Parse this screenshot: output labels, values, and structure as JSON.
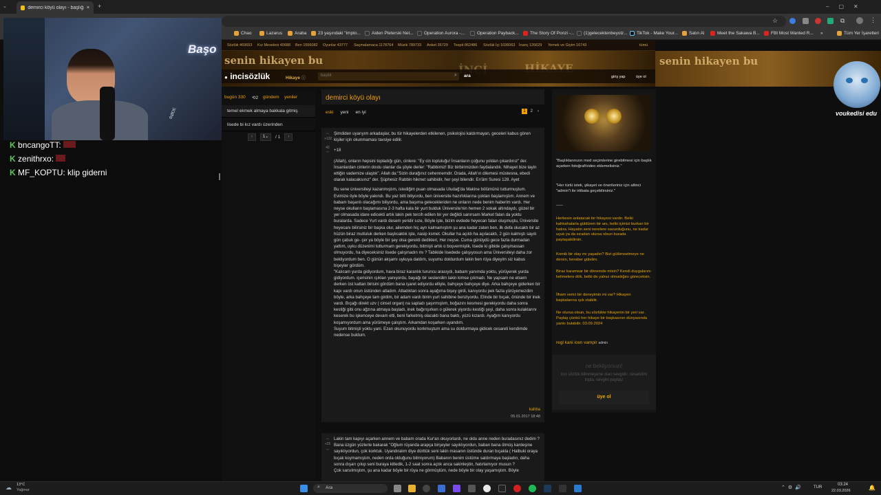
{
  "browser": {
    "tab_title": "demirci köyü olayı - başlığı açan",
    "tab_close": "×",
    "new_tab": "+",
    "bookmarks": [
      {
        "label": "Chao",
        "color": "#e5a23a"
      },
      {
        "label": "Lazarus",
        "color": "#e5a23a"
      },
      {
        "label": "Araba",
        "color": "#e5a23a"
      },
      {
        "label": "23 yaşındaki \"impto...",
        "color": "#e5a23a"
      },
      {
        "label": "Aiden Pleterski Net...",
        "color": "#333"
      },
      {
        "label": "Operation Aurora -...",
        "color": "#333"
      },
      {
        "label": "Operation Payback...",
        "color": "#333"
      },
      {
        "label": "The Story Of Ponzi -...",
        "color": "#d22"
      },
      {
        "label": "(1)gelecektenbeyolz...",
        "color": "#333"
      },
      {
        "label": "TikTok - Make Your...",
        "color": "#111"
      },
      {
        "label": "Satın Al",
        "color": "#e5a23a"
      },
      {
        "label": "Meet the Sakawa B...",
        "color": "#d22"
      },
      {
        "label": "FBI Most Wanted R...",
        "color": "#d22"
      },
      {
        "label": "»",
        "color": ""
      },
      {
        "label": "Tüm Yer İşaretleri",
        "color": "#e5a23a"
      }
    ]
  },
  "site": {
    "top_links": [
      "Sözlük 469693",
      "Kız Meselesi 40688",
      "Ben 1556082",
      "Oyunlar 43777",
      "Saçmalamaca 1178764",
      "Müzik 789733",
      "Anket 35729",
      "Tespit 862486",
      "Sözlük İçi 1036063",
      "İnanç 126629",
      "Yemek ve Giyim 16743",
      "tümü"
    ],
    "logo": "incisözlük",
    "section": "Hikaye",
    "search_placeholder": "başlık",
    "search_button": "ara",
    "login": "giriş yap",
    "signup": "üye ol",
    "banner_left": "senin hikayen bu",
    "banner_mid1": "İNCİ",
    "banner_mid2": "HİKAYE",
    "banner_right": "senin hikayen bu"
  },
  "left": {
    "today": "bugün 330",
    "refresh_count": "2",
    "gundem": "gündem",
    "yeniler": "yeniler",
    "topics": [
      "temel ekmek almaya bakkala gitmiş",
      "lisede bi kız vardı üzerinden"
    ],
    "page_current": "1",
    "page_total": "/ 1",
    "prev": "‹",
    "next": "›"
  },
  "topic": {
    "title": "demirci köyü olayı",
    "tabs": [
      "eski",
      "yeni",
      "en iyi"
    ],
    "pages": [
      "1",
      "2",
      "›"
    ]
  },
  "entries": [
    {
      "votes_up": "+132",
      "votes_down": "42",
      "author": "kahba",
      "date": "05.01.2017 18:48",
      "paragraphs": [
        "Şimdiden uyarıyım arkadaşlar, bu tür hikayelerden etkilenen, psikolojisi kaldırmayan, geceleri kabus gören kişiler için okunmaması tavsiye edilir.",
        "+18",
        "(Allah), onların hepsini topladığı gün, cinlere: \"Ey cin topluluğu! İnsanların çoğunu yoldan çıkardınız\" der. İnsanlardan cinlerin dostu olanlar da şöyle derler: \"Rabbimiz! Biz birbirimizden faydalandık. Nihayet bize tayin ettiğin vademize ulaştık\". Allah da:\"Sizin durağınız cehennemdir. Orada, Allah'ın dilemesi müstesna, ebedi olarak kalacaksınız\" der. Şüphesiz Rabbin hikmet sahibidir, her şeyi bilendir. En'âm Suresi 128. Ayet",
        "Bu sene üniversiteyi kazanmıştım, istediğim puan olmasada Uludağ'da Makine bölümünü tutturmuştum. Evimize öyle böyle yakındı. Bu yaz bitti biliyordu, ben üniversite hazırlıklarına çoktan başlamıştım. Annem ve babam başarılı olacağımı biliyordu, ama başıma gelecekleriden ne onların nede benim haberim vardı. Her neyse okulların başlamasına 2-3 hafta kala bir yurt bulduk Üniversite'nin hemen 2 sokak altındaydı, güzel bir yer olmasada idare edicekti artık lakin pek tercih edilen bir yer değildi sanırsam Market falan da yoktu buralarda. Sadece Yurt vardı desem yeridir sıze, Böyle işte, bizim evdede heyecan falan oluşmuştu, Üniversite heyecanı bilirsiniz bir başka olur, ailemden hiç ayrı kalmamıştım şu ana kadar zaten ben, ilk defa olucaktı bir az hüzün biraz mutluluk derken başlıcaktık işte, nasip ksmet. Okullar ha açıldı ha açılacaktı, 2 gün kalmıştı sayılı gün çabuk ge- çer ya böyle bir şey olsa gerekti dedikleri, Her neyse. Cuma günüydü gece fazla durmadan yattım, uyku düzenimi tutturmam gerekiyordu, bitmişti artık o boşvermişlik, lisede ki gibide çalışmassan olmuyordu, ha diyeceksiniz lisede çalışmadın mı ? Tabikide lisedede çalışıyosun ama Üniversiteyi daha zor bekliyordum ben. O günün akşamı uykuya daldım, suyumu doldurdum lakin ben rüya diyeyim siz kabus bişeyler gördüm.",
        "\"Kalıcam yurda gidiyordum, hava biraz karanlık turuncu arasıydı, babam yanımda yoktu, yürüyerek yurda gidiyordum. içerisinin ışıkları yanıyordu, bayağı bir seslendim lakin kimse çıkmadı. Ne yapsam ne etsem derken üst kattan birisini gördüm bana işaret ediyordu elliyle, bahçeye bahçeye diye. Arka bahçeye giderken bir kapı vardı onun üstünden atladım. Atladıktan sonra ayağıma bişey girdi, kanıyordu pek fazla yürüyemezdim böyle, arka bahçeye tam girdim, bir adam vardı birim yurt sahibine benziyordu. Elinde bir bıçak, önünde bir inek vardı. Bıçağı direkt uzv ( cinsel organ) na sapladı şaşırmıştım, boğazını kesmesi gerekiyordu daha sonra kestiği gibi onu ağzına atmaya başladı, inek bağırışırken o gülerek yiyordu kestiği şeyi, daha sonra kulaklarını keserek bu işkenceye devam etti, beni farketmiş olacaktı bana baktı, yüzü kızardı. Ayağım kanıyordu koşamıyordum ama yürümeye çalıştım. Arkamdan koşarken uyandım.",
        "Suyum bitmişti yoktu yani. Ezan okunuyordu korkmuştum ama su doldurmaya gidicek cesareti kendimde nedense buldum."
      ]
    },
    {
      "votes_up": "+25",
      "votes_down": "",
      "paragraphs": [
        "Lakin tam kapıyı açarken annem ve babam orada Kur'an okuyorlardı, ne oldu anne neden buradasınız dedim ? Bana üzgün yüzlerle bakarak \"Oğlum rüyanda arapça birşeyler sayıklıyordun, baban bana ölmüş kardeşine sayıklıyordun, çok korktuk. Uyandıralım diye dürttük seni lakin masanın üstünde duran bıçakla ( Halbuki oraya bıçak koymamıştım, neden orda olduğunu bilmiyorum) Babanın benim üstüme saldırmaya başladın, daha sonra dışarı çıkıp seni buraya kitledik, 1-2 saat sonra açtık anca sakinleştin, hatırlamıyor musun ?",
        "Çok sarsılmıştım, şu ana kadar böyle bir rüya ne görmüştüm, nede böyle bir olay yaşamıştım. Böyle"
      ]
    }
  ],
  "right": {
    "quote1": "\"Başlıklarınızın mod seçimlerine girebilmesi için başlık açarken fotoğraf/video eklemelisiniz.\"",
    "quote2": "\"Her türlü istek, şikayet ve önerileriniz için altinci \"admin\"i ile irtibata geçebilirsiniz.\"",
    "sep": "___",
    "promo": [
      "Herkesin anlatacak bir hikayesi vardır. Belki kahkahalarla güldüren bir anı, belki içimizi burkan bir hatıra. Hayatın seni nerelere savurduğunu, ne kadar uçuk ya da sıradan olursa olsun burada paylaşabilirsin.",
      "Komik bir olay mı yaşadın? Bizi gülümsetmeye ne dersin, beraber gülelim.",
      "Biraz karamsar bir dönemde misin? Kendi duygularını kelimelere dök, belki de yalnız olmadığını göreceksin.",
      "İlham verici bir deneyimin mi var? Hikayen başkalarına ışık olabilir.",
      "Ne olursa olsun, bu sözlükte hikayenin bir yeri var. Paylaş çünkü her hikaye bir başkasının dünyasında yankı bulabilir. 03.09.2024"
    ],
    "signature": "regl kani icen vampir",
    "signature_role": "admin",
    "guest_title": "ne bekliyorsun!",
    "guest_text": "inci sözlük bilinmeyene olan sevgidir. cesaretini topla, sevgini paylaş!",
    "guest_button": "üye ol"
  },
  "overlay": {
    "cam_text": "Başo",
    "mic_brand": "RØDE",
    "cat_caption": "voukedisi edu",
    "chat": [
      {
        "user": "bncangoTT:",
        "msg": ""
      },
      {
        "user": "zenithrxo:",
        "msg": ""
      },
      {
        "user": "MF_KOPTU:",
        "msg": "klip giderni"
      }
    ]
  },
  "taskbar": {
    "weather_temp": "13°C",
    "weather_desc": "Yağmur",
    "search": "Ara",
    "lang": "TUR",
    "time": "03:24",
    "date": "22.03.2026"
  }
}
